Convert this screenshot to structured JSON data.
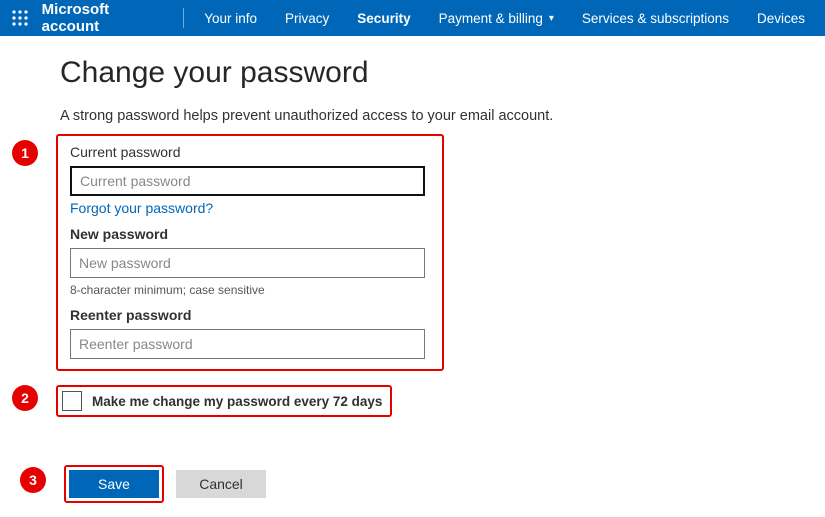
{
  "header": {
    "brand": "Microsoft account",
    "nav": [
      {
        "label": "Your info"
      },
      {
        "label": "Privacy"
      },
      {
        "label": "Security"
      },
      {
        "label": "Payment & billing"
      },
      {
        "label": "Services & subscriptions"
      },
      {
        "label": "Devices"
      }
    ]
  },
  "page": {
    "title": "Change your password",
    "subtitle": "A strong password helps prevent unauthorized access to your email account."
  },
  "fields": {
    "current": {
      "label": "Current password",
      "placeholder": "Current password"
    },
    "forgot_link": "Forgot your password?",
    "newpw": {
      "label": "New password",
      "placeholder": "New password",
      "hint": "8-character minimum; case sensitive"
    },
    "reenter": {
      "label": "Reenter password",
      "placeholder": "Reenter password"
    }
  },
  "checkbox": {
    "label": "Make me change my password every 72 days"
  },
  "buttons": {
    "save": "Save",
    "cancel": "Cancel"
  },
  "annotations": {
    "one": "1",
    "two": "2",
    "three": "3"
  }
}
